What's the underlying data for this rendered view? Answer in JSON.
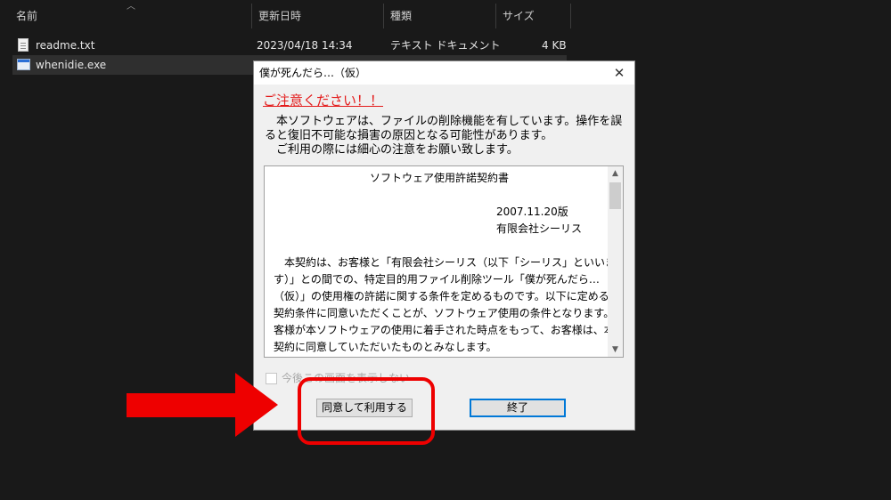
{
  "explorer": {
    "columns": {
      "name": "名前",
      "modified": "更新日時",
      "type": "種類",
      "size": "サイズ"
    },
    "files": [
      {
        "name": "readme.txt",
        "modified": "2023/04/18 14:34",
        "type": "テキスト ドキュメント",
        "size": "4 KB",
        "icon": "text-file-icon"
      },
      {
        "name": "whenidie.exe",
        "modified": "",
        "type": "",
        "size": "",
        "icon": "exe-file-icon"
      }
    ]
  },
  "dialog": {
    "title": "僕が死んだら…（仮）",
    "close_glyph": "✕",
    "warning_title": "ご注意ください！！",
    "warning_lines": [
      "　本ソフトウェアは、ファイルの削除機能を有しています。操作を誤",
      "ると復旧不可能な損害の原因となる可能性があります。",
      "　ご利用の際には細心の注意をお願い致します。"
    ],
    "license": {
      "heading": "ソフトウェア使用許諾契約書",
      "version": "2007.11.20版",
      "company": "有限会社シーリス",
      "body_lines": [
        "　本契約は、お客様と「有限会社シーリス（以下「シーリス」といいま",
        "す）」との間での、特定目的用ファイル削除ツール「僕が死んだら…",
        "（仮）」の使用権の許諾に関する条件を定めるものです。以下に定める",
        "契約条件に同意いただくことが、ソフトウェア使用の条件となります。お",
        "客様が本ソフトウェアの使用に着手された時点をもって、お客様は、本",
        "契約に同意していただいたものとみなします。"
      ]
    },
    "checkbox_label": "今後この画面を表示しない",
    "agree_button": "同意して利用する",
    "exit_button": "終了"
  },
  "colors": {
    "background": "#191919",
    "annotation_red": "#ee0000",
    "warning_red": "#e31b1b",
    "focus_blue": "#0078d7"
  }
}
